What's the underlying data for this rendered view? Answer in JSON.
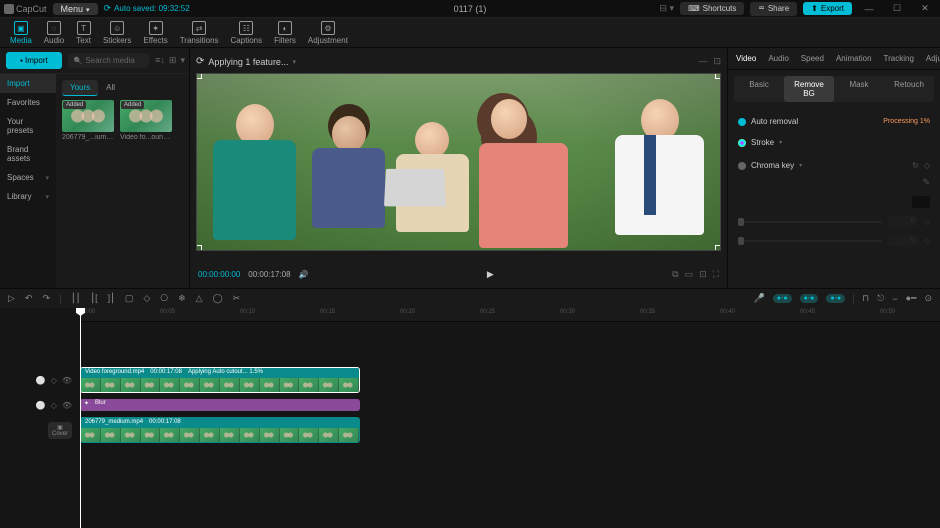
{
  "titlebar": {
    "app": "CapCut",
    "menu": "Menu",
    "autosave": "Auto saved: 09:32:52",
    "title": "0117 (1)",
    "shortcuts": "Shortcuts",
    "share": "Share",
    "export": "Export"
  },
  "toolbar": {
    "tabs": [
      "Media",
      "Audio",
      "Text",
      "Stickers",
      "Effects",
      "Transitions",
      "Captions",
      "Filters",
      "Adjustment"
    ],
    "active": 0
  },
  "left": {
    "import": "Import",
    "search_placeholder": "Search media",
    "sidebar": [
      "Import",
      "Favorites",
      "Your presets",
      "Brand assets",
      "Spaces",
      "Library"
    ],
    "sidebar_active": 0,
    "media_tabs": [
      "Yours",
      "All"
    ],
    "media_active": 0,
    "thumbs": [
      {
        "badge": "Added",
        "name": "206779_...ium.mp4"
      },
      {
        "badge": "Added",
        "name": "Video fo...ound.mp4"
      }
    ]
  },
  "preview": {
    "status": "Applying 1 feature...",
    "tc_current": "00:00:00:00",
    "tc_total": "00:00:17:08"
  },
  "right": {
    "tabs": [
      "Video",
      "Audio",
      "Speed",
      "Animation",
      "Tracking",
      "Adjustment"
    ],
    "active": 0,
    "subtabs": [
      "Basic",
      "Remove BG",
      "Mask",
      "Retouch"
    ],
    "sub_active": 1,
    "auto_removal": "Auto removal",
    "auto_removal_status": "Processing 1%",
    "stroke": "Stroke",
    "chroma": "Chroma key",
    "val_zero": "0"
  },
  "ruler": [
    "00:00",
    "00:05",
    "00:10",
    "00:15",
    "00:20",
    "00:25",
    "00:30",
    "00:35",
    "00:40",
    "00:45",
    "00:50"
  ],
  "clips": {
    "c1_name": "Video foreground.mp4",
    "c1_dur": "00:00:17:08",
    "c1_status": "Applying Auto cutout... 1.5%",
    "fx": "Blur",
    "c2_name": "206779_medium.mp4",
    "c2_dur": "00:00:17:08",
    "cover": "Cover"
  }
}
